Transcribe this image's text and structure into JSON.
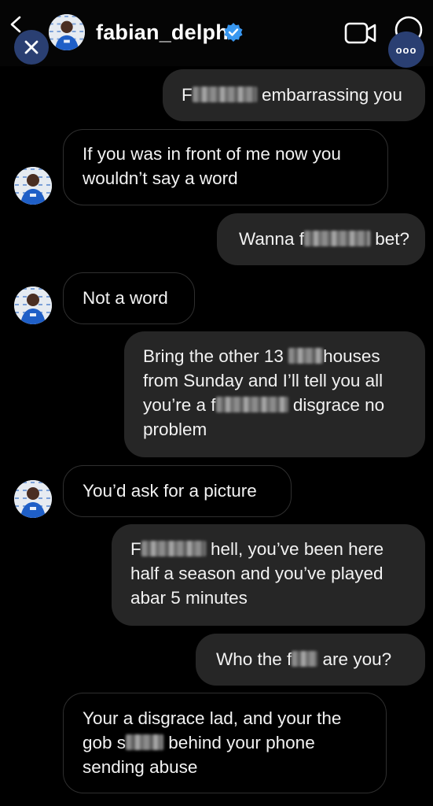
{
  "header": {
    "username": "fabian_delph"
  },
  "icons": {
    "back": "chevron-left-icon",
    "close": "close-icon",
    "verified": "verified-badge-icon",
    "video": "video-camera-icon",
    "info": "info-icon",
    "more": "more-icon"
  },
  "colors": {
    "background": "#000000",
    "outgoing_bubble": "#262626",
    "incoming_border": "#2f2f2f",
    "verified": "#3897f0",
    "overlay_button": "#2a3f72"
  },
  "messages": [
    {
      "sender": "me",
      "parts": [
        "F",
        "[blurred]",
        " embarrassing you"
      ]
    },
    {
      "sender": "them",
      "lines": [
        "If you was in front of me now you",
        "wouldn’t say a word"
      ]
    },
    {
      "sender": "me",
      "parts": [
        "Wanna f",
        "[blurred]",
        " bet?"
      ]
    },
    {
      "sender": "them",
      "lines": [
        "Not a word"
      ]
    },
    {
      "sender": "me",
      "lines": [
        "Bring the other 13 [blurred]houses",
        "from Sunday and I’ll tell you all",
        "you’re a f[blurred] disgrace no",
        "problem"
      ]
    },
    {
      "sender": "them",
      "lines": [
        "You’d ask for a picture"
      ]
    },
    {
      "sender": "me",
      "lines": [
        "F[blurred] hell, you’ve been here",
        "half a season and you’ve played",
        "abar 5 minutes"
      ]
    },
    {
      "sender": "me",
      "parts": [
        "Who the f",
        "[blurred]",
        " are you?"
      ]
    },
    {
      "sender": "them",
      "lines": [
        "Your a disgrace lad, and your the",
        "gob s[blurred] behind your phone",
        "sending abuse"
      ]
    }
  ],
  "text": {
    "m1a": "F",
    "m1b": " embarrassing you",
    "m2l1": "If you was in front of me now you",
    "m2l2": "wouldn’t say a word",
    "m3a": "Wanna f",
    "m3b": " bet?",
    "m4": "Not a word",
    "m5l1a": "Bring the other 13 ",
    "m5l1b": "houses",
    "m5l2": "from Sunday and I’ll tell you all",
    "m5l3a": "you’re a f",
    "m5l3b": " disgrace no",
    "m5l4": "problem",
    "m6": "You’d ask for a picture",
    "m7l1a": "F",
    "m7l1b": " hell, you’ve been here",
    "m7l2": "half a season and you’ve played",
    "m7l3": "abar 5 minutes",
    "m8a": "Who the f",
    "m8b": " are you?",
    "m9l1": "Your a disgrace lad, and your the",
    "m9l2a": "gob s",
    "m9l2b": " behind your phone",
    "m9l3": "sending abuse"
  }
}
